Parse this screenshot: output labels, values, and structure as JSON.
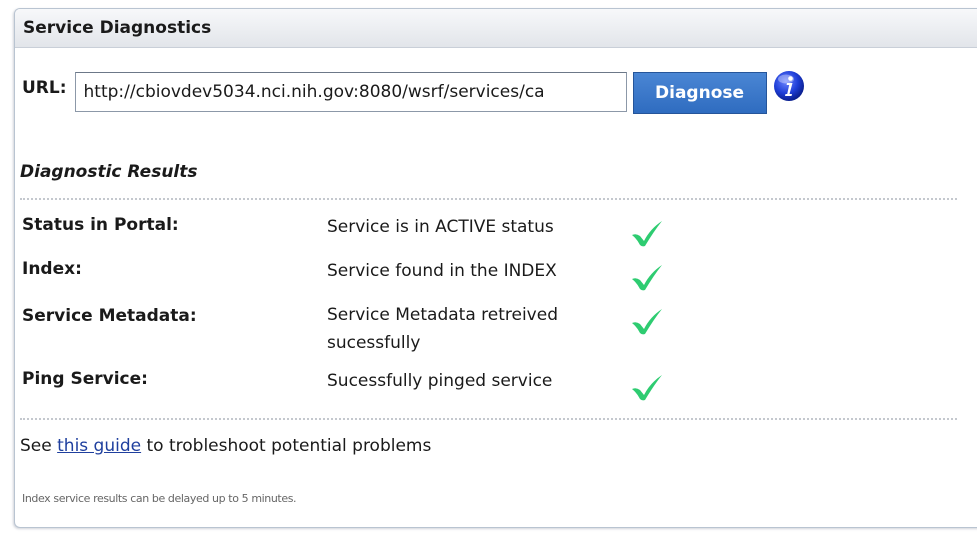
{
  "panel": {
    "title": "Service Diagnostics"
  },
  "url_form": {
    "label": "URL:",
    "value": "http://cbiovdev5034.nci.nih.gov:8080/wsrf/services/ca",
    "button_label": "Diagnose",
    "info_icon": "info-icon"
  },
  "results": {
    "title": "Diagnostic Results",
    "rows": [
      {
        "label": "Status in Portal:",
        "value": "Service is in ACTIVE status",
        "icon": "check-icon"
      },
      {
        "label": "Index:",
        "value": "Service found in the INDEX",
        "icon": "check-icon"
      },
      {
        "label": "Service Metadata:",
        "value": "Service Metadata retreived sucessfully",
        "icon": "check-icon"
      },
      {
        "label": "Ping Service:",
        "value": "Sucessfully pinged service",
        "icon": "check-icon"
      }
    ]
  },
  "guide": {
    "prefix": "See ",
    "link_text": "this guide",
    "suffix": " to trobleshoot potential problems"
  },
  "footnote": "Index service results can be delayed up to 5 minutes.",
  "colors": {
    "button": "#2f6cc0",
    "link": "#1f3f9e",
    "check": "#2ecc71"
  }
}
